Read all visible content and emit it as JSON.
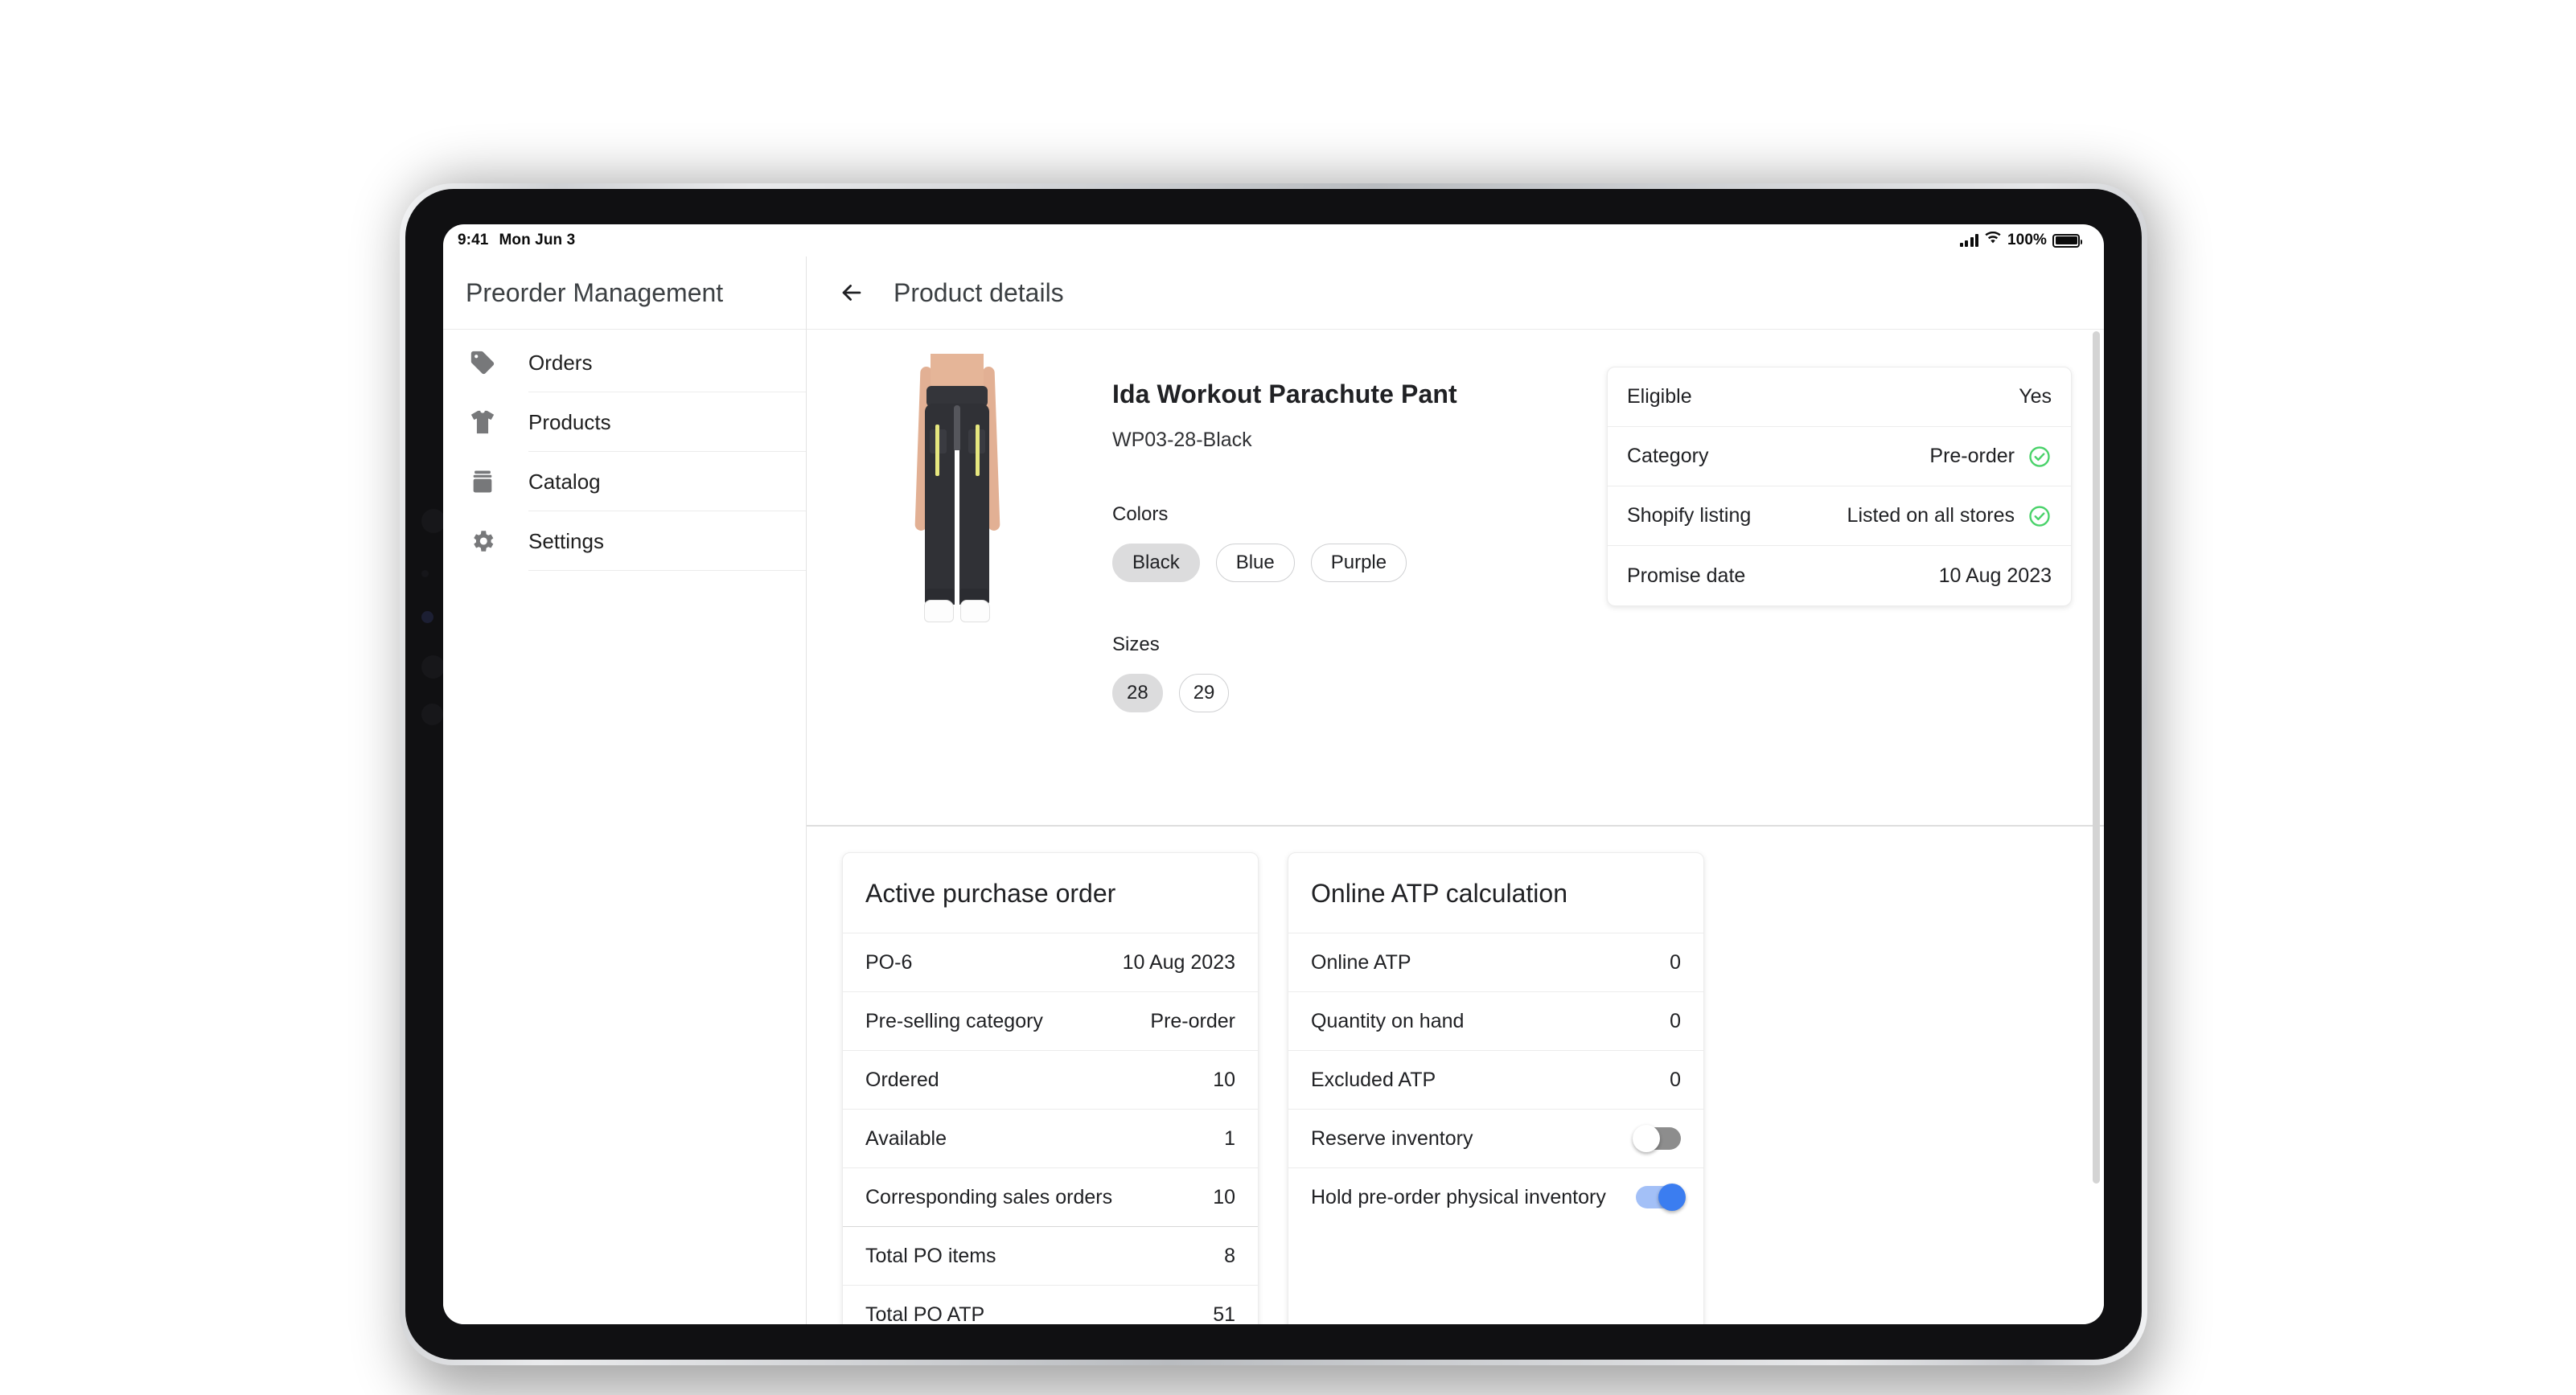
{
  "status_bar": {
    "time": "9:41",
    "date": "Mon Jun 3",
    "battery_percent": "100%",
    "signal_icon": "cellular-bars-icon",
    "wifi_icon": "wifi-icon",
    "battery_icon": "battery-full-icon"
  },
  "sidebar": {
    "title": "Preorder Management",
    "items": [
      {
        "label": "Orders",
        "icon": "tag-icon"
      },
      {
        "label": "Products",
        "icon": "tshirt-icon"
      },
      {
        "label": "Catalog",
        "icon": "box-icon"
      },
      {
        "label": "Settings",
        "icon": "gear-icon"
      }
    ]
  },
  "main": {
    "back_icon": "arrow-left-icon",
    "title": "Product details"
  },
  "product": {
    "image_alt": "ida-workout-parachute-pant-photo",
    "name": "Ida Workout Parachute Pant",
    "sku": "WP03-28-Black",
    "colors_label": "Colors",
    "colors": [
      {
        "label": "Black",
        "selected": true
      },
      {
        "label": "Blue",
        "selected": false
      },
      {
        "label": "Purple",
        "selected": false
      }
    ],
    "sizes_label": "Sizes",
    "sizes": [
      {
        "label": "28",
        "selected": true
      },
      {
        "label": "29",
        "selected": false
      }
    ]
  },
  "eligibility_card": {
    "rows": [
      {
        "label": "Eligible",
        "value": "Yes",
        "check": false
      },
      {
        "label": "Category",
        "value": "Pre-order",
        "check": true
      },
      {
        "label": "Shopify listing",
        "value": "Listed on all stores",
        "check": true
      },
      {
        "label": "Promise date",
        "value": "10 Aug 2023",
        "check": false
      }
    ]
  },
  "purchase_order_card": {
    "title": "Active purchase order",
    "rows": [
      {
        "label": "PO-6",
        "value": "10 Aug 2023",
        "separator_above": false
      },
      {
        "label": "Pre-selling category",
        "value": "Pre-order",
        "separator_above": false
      },
      {
        "label": "Ordered",
        "value": "10",
        "separator_above": false
      },
      {
        "label": "Available",
        "value": "1",
        "separator_above": false
      },
      {
        "label": "Corresponding sales orders",
        "value": "10",
        "separator_above": false
      },
      {
        "label": "Total PO items",
        "value": "8",
        "separator_above": true
      },
      {
        "label": "Total PO ATP",
        "value": "51",
        "separator_above": false
      }
    ]
  },
  "atp_card": {
    "title": "Online ATP calculation",
    "rows": [
      {
        "label": "Online ATP",
        "value": "0",
        "type": "value"
      },
      {
        "label": "Quantity on hand",
        "value": "0",
        "type": "value"
      },
      {
        "label": "Excluded ATP",
        "value": "0",
        "type": "value"
      },
      {
        "label": "Reserve inventory",
        "type": "toggle",
        "on": false
      },
      {
        "label": "Hold pre-order physical inventory",
        "type": "toggle",
        "on": true
      }
    ]
  },
  "colors": {
    "accent_blue": "#3b7df0",
    "accent_blue_track": "#a3c0f7",
    "toggle_off": "#8d8d8d",
    "check_green": "#4ad26a",
    "chip_selected_bg": "#dcdcdd",
    "text_primary": "#202124",
    "text_secondary": "#3c4043"
  }
}
